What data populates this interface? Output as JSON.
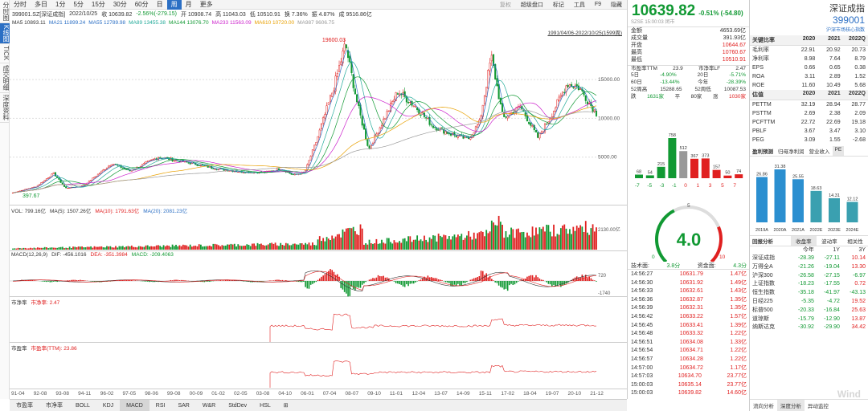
{
  "toolbar": {
    "items": [
      "分时",
      "多日",
      "1分",
      "5分",
      "15分",
      "30分",
      "60分",
      "日",
      "周",
      "月",
      "更多"
    ],
    "active": "周",
    "right": [
      "复权",
      "超级盘口",
      "标记",
      "工具",
      "F9",
      "隐藏"
    ]
  },
  "sidebar": {
    "tabs": [
      "分时图",
      "K线图",
      "TICK",
      "成交明细",
      "深度资料"
    ],
    "active": "K线图"
  },
  "info": {
    "code": "399001.SZ[深证成指]",
    "date": "2022/10/25",
    "close_label": "收",
    "close": "10639.82",
    "chg": "-2.56%(-279.15)",
    "open_label": "开",
    "open": "10908.74",
    "high_label": "高",
    "high": "11043.03",
    "low_label": "低",
    "low": "10510.91",
    "turn_label": "换",
    "turn": "7.36%",
    "amp_label": "振",
    "amp": "4.87%",
    "vol_label": "成",
    "vol": "9516.86亿"
  },
  "ma": [
    {
      "t": "MA5 10893.11",
      "c": "#333333"
    },
    {
      "t": "MA21 11899.24",
      "c": "#2b6fc4"
    },
    {
      "t": "MA55 12789.98",
      "c": "#2b6fc4"
    },
    {
      "t": "MA89 13455.38",
      "c": "#22aa99"
    },
    {
      "t": "MA144 13076.70",
      "c": "#119933"
    },
    {
      "t": "MA233 11563.09",
      "c": "#cc22cc"
    },
    {
      "t": "MA610 10720.00",
      "c": "#e8a000"
    },
    {
      "t": "MA987 9606.75",
      "c": "#999999"
    }
  ],
  "range": "1991/04/06-2022/10/25(1599周)",
  "price_labels": {
    "max": "19600.03",
    "min": "397.67",
    "y15000": "15000.00",
    "y10000": "10000.00",
    "y5000": "5000.00"
  },
  "vol": {
    "label": "VOL: 799.16亿",
    "ma5": "MA(5): 1507.26亿",
    "ma10": "MA(10): 1791.63亿",
    "ma20": "MA(20): 2081.23亿",
    "axis": "2130.00亿"
  },
  "macd": {
    "label": "MACD(12,26,9)",
    "dif": "DIF: -456.1016",
    "dea": "DEA: -351.3984",
    "macd": "MACD: -209.4063",
    "axis_hi": "720",
    "axis_lo": "-1740"
  },
  "pb": {
    "label": "市净率",
    "value": "市净率: 2.47"
  },
  "pe": {
    "label": "市盈率",
    "value": "市盈率(TTM): 23.86"
  },
  "xaxis": [
    "91-04",
    "92-08",
    "93-08",
    "94-11",
    "96-02",
    "97-05",
    "98-06",
    "99-08",
    "00-09",
    "01-02",
    "02-05",
    "03-08",
    "04-10",
    "06-01",
    "07-04",
    "08-07",
    "09-10",
    "11-01",
    "12-04",
    "13-07",
    "14-09",
    "15-11",
    "17-02",
    "18-04",
    "19-07",
    "20-10",
    "21-12"
  ],
  "bottom_tabs": [
    "市盈率",
    "市净率",
    "BOLL",
    "KDJ",
    "MACD",
    "RSI",
    "SAR",
    "W&R",
    "StdDev",
    "HSL",
    "⊞"
  ],
  "bottom_active": "MACD",
  "quote": {
    "price": "10639.82",
    "chg": "-0.51%",
    "chg_pts": "(-54.80)",
    "name": "深证成指",
    "code": "399001",
    "market": "SZSE 15:00:03 闭市",
    "link": "沪深市场核心指数",
    "kv": [
      [
        "金额",
        "4653.69亿"
      ],
      [
        "成交量",
        "391.93亿"
      ],
      [
        "开盘",
        "10644.67"
      ],
      [
        "最高",
        "10760.67"
      ],
      [
        "最低",
        "10510.91"
      ]
    ],
    "pe_row": [
      "市盈率TTM",
      "23.9",
      "市净率LF",
      "2.47"
    ],
    "perf": [
      [
        "5日",
        "-4.90%",
        "20日",
        "-5.71%"
      ],
      [
        "60日",
        "-13.44%",
        "今年",
        "-28.39%"
      ],
      [
        "52周高",
        "15288.65",
        "52周低",
        "10087.53"
      ]
    ],
    "breadth": [
      "跌",
      "1631家",
      "平",
      "80家",
      "涨",
      "1030家"
    ],
    "dist": {
      "counts": [
        "68",
        "54",
        "215",
        "758",
        "512",
        "367",
        "373",
        "157",
        "50",
        "74"
      ],
      "values": [
        68,
        54,
        215,
        758,
        512,
        367,
        373,
        157,
        50,
        74
      ],
      "labels": [
        "-7",
        "-5",
        "-3",
        "-1",
        "0",
        "1",
        "3",
        "5",
        "7"
      ]
    },
    "gauge": {
      "value": "4.0",
      "ticks": [
        "5",
        "0",
        "10"
      ],
      "score": 4.0
    },
    "scores": [
      "技术面:",
      "3.8分",
      "资金面:",
      "4.3分"
    ],
    "ticks": [
      [
        "14:56:27",
        "10631.79",
        "1.47亿"
      ],
      [
        "14:56:30",
        "10631.92",
        "1.49亿"
      ],
      [
        "14:56:33",
        "10632.61",
        "1.43亿"
      ],
      [
        "14:56:36",
        "10632.87",
        "1.35亿"
      ],
      [
        "14:56:39",
        "10632.31",
        "1.35亿"
      ],
      [
        "14:56:42",
        "10633.22",
        "1.57亿"
      ],
      [
        "14:56:45",
        "10633.41",
        "1.39亿"
      ],
      [
        "14:56:48",
        "10633.32",
        "1.22亿"
      ],
      [
        "14:56:51",
        "10634.08",
        "1.33亿"
      ],
      [
        "14:56:54",
        "10634.71",
        "1.22亿"
      ],
      [
        "14:56:57",
        "10634.28",
        "1.22亿"
      ],
      [
        "14:57:00",
        "10634.72",
        "1.17亿"
      ],
      [
        "14:57:03",
        "10634.70",
        "23.77亿"
      ],
      [
        "15:00:03",
        "10635.14",
        "23.77亿"
      ],
      [
        "15:00:03",
        "10639.82",
        "14.60亿"
      ]
    ]
  },
  "right": {
    "key_title": "关键比率",
    "years": [
      "2020",
      "2021",
      "2022Q"
    ],
    "key": [
      [
        "毛利率",
        "22.91",
        "20.92",
        "20.73"
      ],
      [
        "净利率",
        "8.98",
        "7.64",
        "8.79"
      ],
      [
        "EPS",
        "0.66",
        "0.65",
        "0.38"
      ],
      [
        "ROA",
        "3.11",
        "2.89",
        "1.52"
      ],
      [
        "ROE",
        "11.60",
        "10.49",
        "5.68"
      ]
    ],
    "val_title": "估值",
    "val": [
      [
        "PETTM",
        "32.19",
        "28.94",
        "28.77"
      ],
      [
        "PSTTM",
        "2.69",
        "2.38",
        "2.09"
      ],
      [
        "PCFTTM",
        "22.72",
        "22.69",
        "19.18"
      ],
      [
        "PBLF",
        "3.67",
        "3.47",
        "3.10"
      ],
      [
        "PEG",
        "3.09",
        "1.55",
        "-2.68"
      ]
    ],
    "fc_tabs": [
      "盈利预测",
      "归母净利润",
      "营业收入",
      "PE"
    ],
    "fc": {
      "values": [
        26.86,
        31.38,
        25.55,
        18.63,
        14.31,
        12.12
      ],
      "labels": [
        "26.86",
        "31.38",
        "25.55",
        "18.63",
        "14.31",
        "12.12"
      ],
      "years": [
        "2019A",
        "2020A",
        "2021A",
        "2022E",
        "2023E",
        "2024E"
      ]
    },
    "ret_title": "回报分析",
    "ret_tabs": [
      "收盘率",
      "波动率",
      "相关性"
    ],
    "ret_cols": [
      "今年",
      "1Y",
      "3Y"
    ],
    "ret": [
      [
        "深证成指",
        "-28.39",
        "-27.11",
        "10.14"
      ],
      [
        "万得全A",
        "-21.26",
        "-19.04",
        "13.30"
      ],
      [
        "沪深300",
        "-26.58",
        "-27.15",
        "-6.97"
      ],
      [
        "上证指数",
        "-18.23",
        "-17.55",
        "0.72"
      ],
      [
        "恒生指数",
        "-35.18",
        "-41.97",
        "-43.13"
      ],
      [
        "日经225",
        "-5.35",
        "-4.72",
        "19.52"
      ],
      [
        "标普500",
        "-20.33",
        "-16.84",
        "25.63"
      ],
      [
        "道琼斯",
        "-15.79",
        "-12.90",
        "13.87"
      ],
      [
        "纳斯达克",
        "-30.92",
        "-29.90",
        "34.42"
      ]
    ],
    "foot": [
      "流向分析",
      "深度分析",
      "异动监控"
    ]
  },
  "watermark": "Wind"
}
